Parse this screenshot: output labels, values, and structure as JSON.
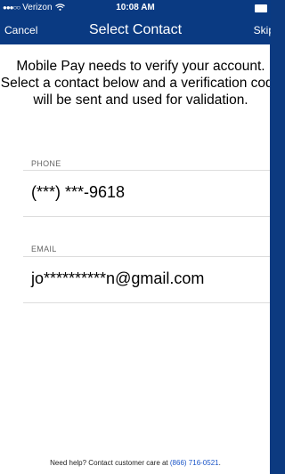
{
  "status_bar": {
    "signal": "●●●○○",
    "carrier": "Verizon",
    "time": "10:08 AM"
  },
  "nav": {
    "cancel_label": "Cancel",
    "title": "Select Contact",
    "skip_label": "Skip"
  },
  "intro_text": "Mobile Pay needs to verify your account. Select a contact below and a verification code will be sent and used for validation.",
  "phone": {
    "label": "PHONE",
    "value": "(***) ***-9618"
  },
  "email": {
    "label": "EMAIL",
    "value": "jo**********n@gmail.com"
  },
  "footer": {
    "text": "Need help? Contact customer care at ",
    "phone_link": "(866) 716-0521",
    "suffix": "."
  },
  "colors": {
    "nav_background": "#0a3a82",
    "link": "#1a55c8"
  }
}
